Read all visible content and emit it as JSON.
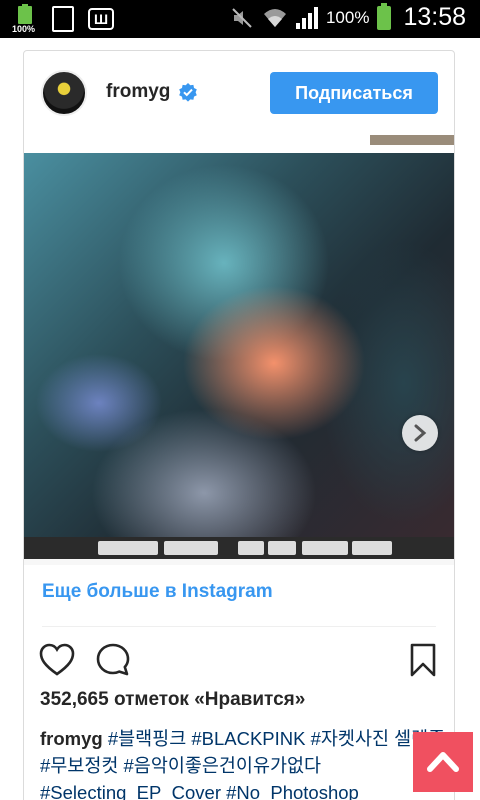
{
  "status_bar": {
    "battery_badge": "100%",
    "doc_icon": "ॶ",
    "app_icon": "Ш",
    "battery_percent": "100%",
    "time": "13:58",
    "icons": [
      "battery-full-icon",
      "document-icon",
      "app-icon",
      "mute-icon",
      "wifi-icon",
      "signal-icon",
      "battery-icon"
    ]
  },
  "post": {
    "username": "fromyg",
    "verified": true,
    "follow_label": "Подписаться",
    "more_link": "Еще больше в Instagram",
    "likes_text": "352,665 отметок «Нравится»",
    "caption_user": "fromyg",
    "caption_tags": "#블랙핑크 #BLACKPINK #자켓사진 셀렉중 #무보정컷 #음악이좋은건이유가없다 #Selecting_EP_Cover #No_Photoshop"
  },
  "colors": {
    "accent": "#3897f0",
    "hashtag": "#003569",
    "scroll_top": "#f05060"
  }
}
